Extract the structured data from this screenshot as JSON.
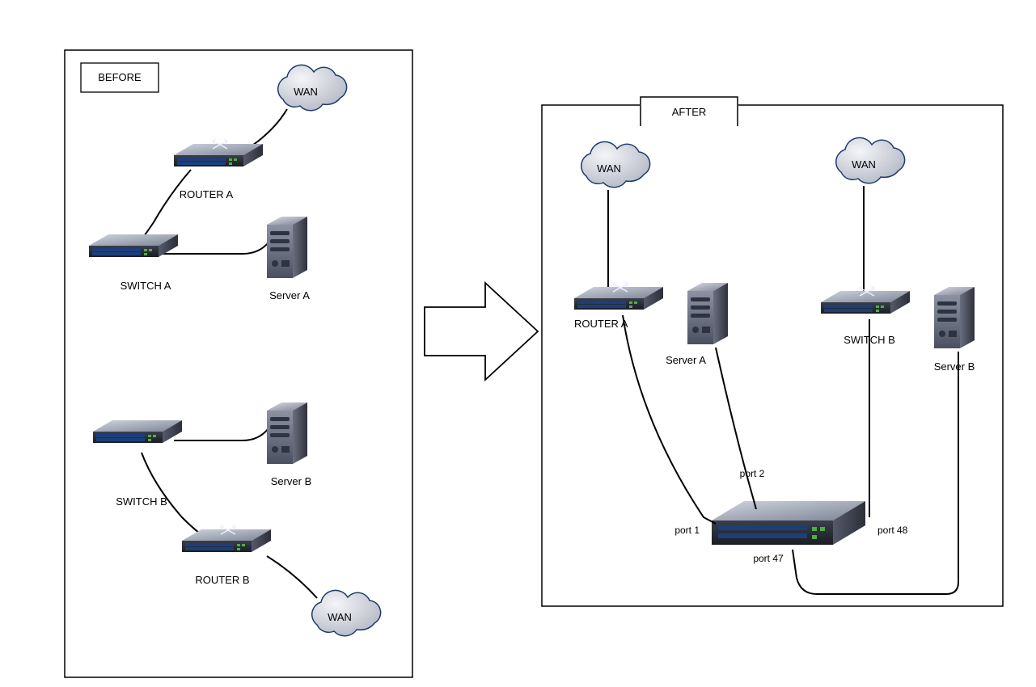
{
  "before": {
    "title": "BEFORE",
    "wan_top": "WAN",
    "wan_bottom": "WAN",
    "router_a": "ROUTER A",
    "router_b": "ROUTER B",
    "switch_a": "SWITCH A",
    "switch_b": "SWITCH B",
    "server_a": "Server A",
    "server_b": "Server B"
  },
  "after": {
    "title": "AFTER",
    "wan_left": "WAN",
    "wan_right": "WAN",
    "router_a": "ROUTER A",
    "switch_b": "SWITCH B",
    "server_a": "Server A",
    "server_b": "Server B",
    "port1": "port 1",
    "port2": "port 2",
    "port47": "port 47",
    "port48": "port 48"
  }
}
